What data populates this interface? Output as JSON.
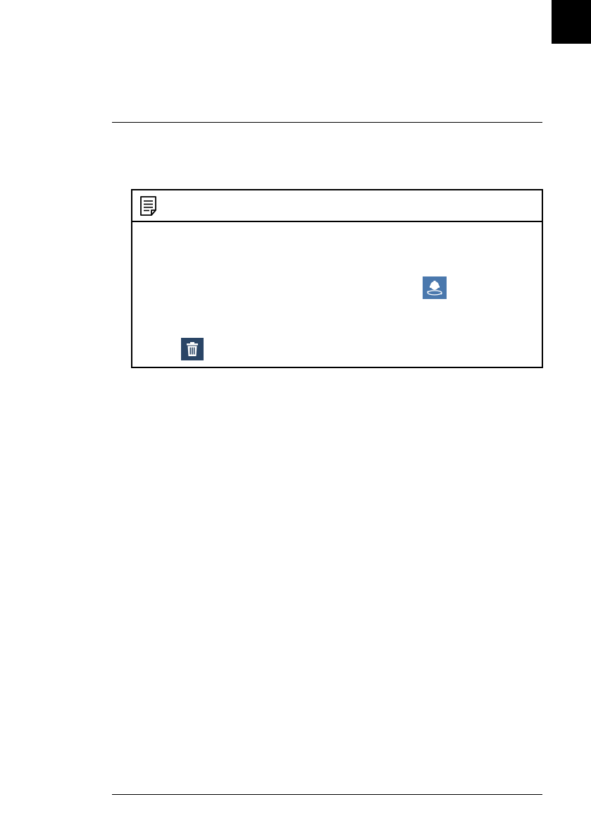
{
  "page": {
    "side_tab_color": "#000000",
    "rule_color": "#000000"
  },
  "note": {
    "icon": "note-icon",
    "body_icons": [
      {
        "icon": "ptz-icon",
        "color": "#4a78ad"
      },
      {
        "icon": "trash-icon",
        "color": "#2a4566"
      }
    ]
  }
}
